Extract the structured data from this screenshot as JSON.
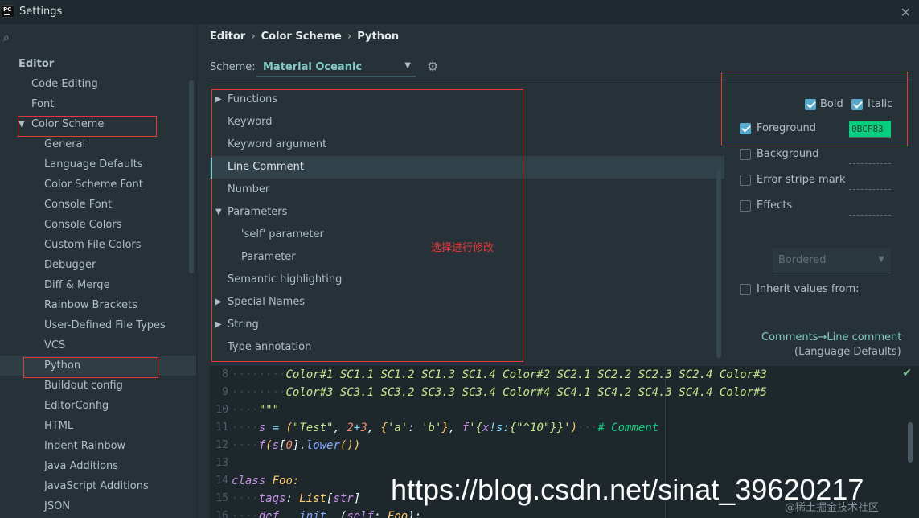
{
  "window": {
    "title": "Settings",
    "logo_text": "PC"
  },
  "sidebar": {
    "items": [
      {
        "label": "Editor",
        "level": 0
      },
      {
        "label": "Code Editing",
        "level": 1
      },
      {
        "label": "Font",
        "level": 1
      },
      {
        "label": "Color Scheme",
        "level": 1,
        "expanded": true
      },
      {
        "label": "General",
        "level": 2
      },
      {
        "label": "Language Defaults",
        "level": 2
      },
      {
        "label": "Color Scheme Font",
        "level": 2
      },
      {
        "label": "Console Font",
        "level": 2
      },
      {
        "label": "Console Colors",
        "level": 2
      },
      {
        "label": "Custom File Colors",
        "level": 2
      },
      {
        "label": "Debugger",
        "level": 2
      },
      {
        "label": "Diff & Merge",
        "level": 2
      },
      {
        "label": "Rainbow Brackets",
        "level": 2
      },
      {
        "label": "User-Defined File Types",
        "level": 2
      },
      {
        "label": "VCS",
        "level": 2
      },
      {
        "label": "Python",
        "level": 2,
        "selected": true
      },
      {
        "label": "Buildout config",
        "level": 2
      },
      {
        "label": "EditorConfig",
        "level": 2
      },
      {
        "label": "HTML",
        "level": 2
      },
      {
        "label": "Indent Rainbow",
        "level": 2
      },
      {
        "label": "Java Additions",
        "level": 2
      },
      {
        "label": "JavaScript Additions",
        "level": 2
      },
      {
        "label": "JSON",
        "level": 2
      }
    ]
  },
  "breadcrumb": [
    "Editor",
    "Color Scheme",
    "Python"
  ],
  "scheme": {
    "label": "Scheme:",
    "value": "Material Oceanic"
  },
  "tree": {
    "items": [
      {
        "label": "Functions",
        "level": 0,
        "arrow": "right"
      },
      {
        "label": "Keyword",
        "level": 0
      },
      {
        "label": "Keyword argument",
        "level": 0
      },
      {
        "label": "Line Comment",
        "level": 0,
        "selected": true
      },
      {
        "label": "Number",
        "level": 0
      },
      {
        "label": "Parameters",
        "level": 0,
        "arrow": "down"
      },
      {
        "label": "'self' parameter",
        "level": 1
      },
      {
        "label": "Parameter",
        "level": 1
      },
      {
        "label": "Semantic highlighting",
        "level": 0
      },
      {
        "label": "Special Names",
        "level": 0,
        "arrow": "right"
      },
      {
        "label": "String",
        "level": 0,
        "arrow": "right"
      },
      {
        "label": "Type annotation",
        "level": 0
      }
    ],
    "annotation": "选择进行修改"
  },
  "props": {
    "bold_label": "Bold",
    "italic_label": "Italic",
    "foreground_label": "Foreground",
    "foreground_value": "0BCF83",
    "background_label": "Background",
    "error_stripe_label": "Error stripe mark",
    "effects_label": "Effects",
    "effects_value": "Bordered",
    "inherit_label": "Inherit values from:",
    "inherit_link": "Comments→Line comment",
    "inherit_sub": "(Language Defaults)"
  },
  "colors": {
    "foreground": "#06cf83",
    "accent": "#80cbc4",
    "annotation": "#e53935"
  },
  "editor": {
    "line_numbers": [
      "8",
      "9",
      "10",
      "11",
      "12",
      "13",
      "14",
      "15",
      "16"
    ]
  },
  "watermark": {
    "text": "https://blog.csdn.net/sinat_39620217",
    "small": "@稀土掘金技术社区"
  }
}
